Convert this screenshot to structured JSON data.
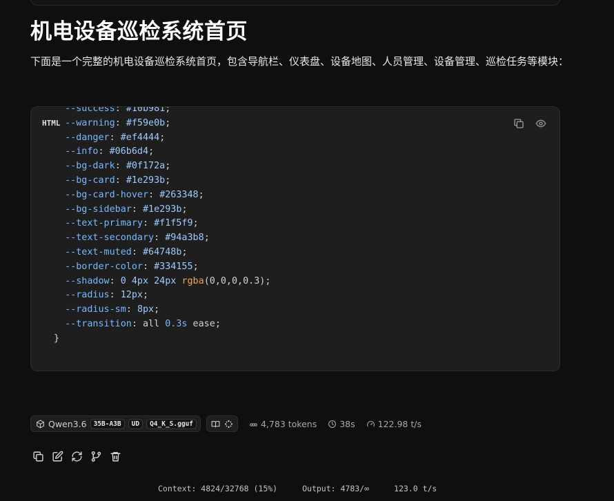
{
  "page": {
    "title": "机电设备巡检系统首页",
    "intro": "下面是一个完整的机电设备巡检系统首页，包含导航栏、仪表盘、设备地图、人员管理、设备管理、巡检任务等模块："
  },
  "code_block": {
    "language": "HTML",
    "lines": [
      {
        "prop": "  --success",
        "val": "#10b981",
        "tail": ";"
      },
      {
        "prop": "  --warning",
        "val": "#f59e0b",
        "tail": ";"
      },
      {
        "prop": "  --danger",
        "val": "#ef4444",
        "tail": ";"
      },
      {
        "prop": "  --info",
        "val": "#06b6d4",
        "tail": ";"
      },
      {
        "prop": "  --bg-dark",
        "val": "#0f172a",
        "tail": ";"
      },
      {
        "prop": "  --bg-card",
        "val": "#1e293b",
        "tail": ";"
      },
      {
        "prop": "  --bg-card-hover",
        "val": "#263348",
        "tail": ";"
      },
      {
        "prop": "  --bg-sidebar",
        "val": "#1e293b",
        "tail": ";"
      },
      {
        "prop": "  --text-primary",
        "val": "#f1f5f9",
        "tail": ";"
      },
      {
        "prop": "  --text-secondary",
        "val": "#94a3b8",
        "tail": ";"
      },
      {
        "prop": "  --text-muted",
        "val": "#64748b",
        "tail": ";"
      },
      {
        "prop": "  --border-color",
        "val": "#334155",
        "tail": ";"
      },
      {
        "prop": "  --shadow",
        "val": "0 4px 24px ",
        "fn": "rgba",
        "args": "(0,0,0,0.3)",
        "tail": ";"
      },
      {
        "prop": "  --radius",
        "val": "12px",
        "tail": ";"
      },
      {
        "prop": "  --radius-sm",
        "val": "8px",
        "tail": ";"
      },
      {
        "prop": "  --transition",
        "val": "all ",
        "num": "0.3s",
        "rest": " ease",
        "tail": ";"
      }
    ],
    "closing": "}",
    "icons": [
      "copy-icon",
      "eye-icon"
    ]
  },
  "generation_info": {
    "model": "Qwen3.6",
    "tags": [
      "35B-A3B",
      "UD",
      "Q4_K_S.gguf"
    ],
    "tokens": "4,783 tokens",
    "time": "38s",
    "speed": "122.98 t/s"
  },
  "status_bar": {
    "context": "Context: 4824/32768 (15%)",
    "output": "Output: 4783/∞",
    "rate": "123.0 t/s"
  }
}
